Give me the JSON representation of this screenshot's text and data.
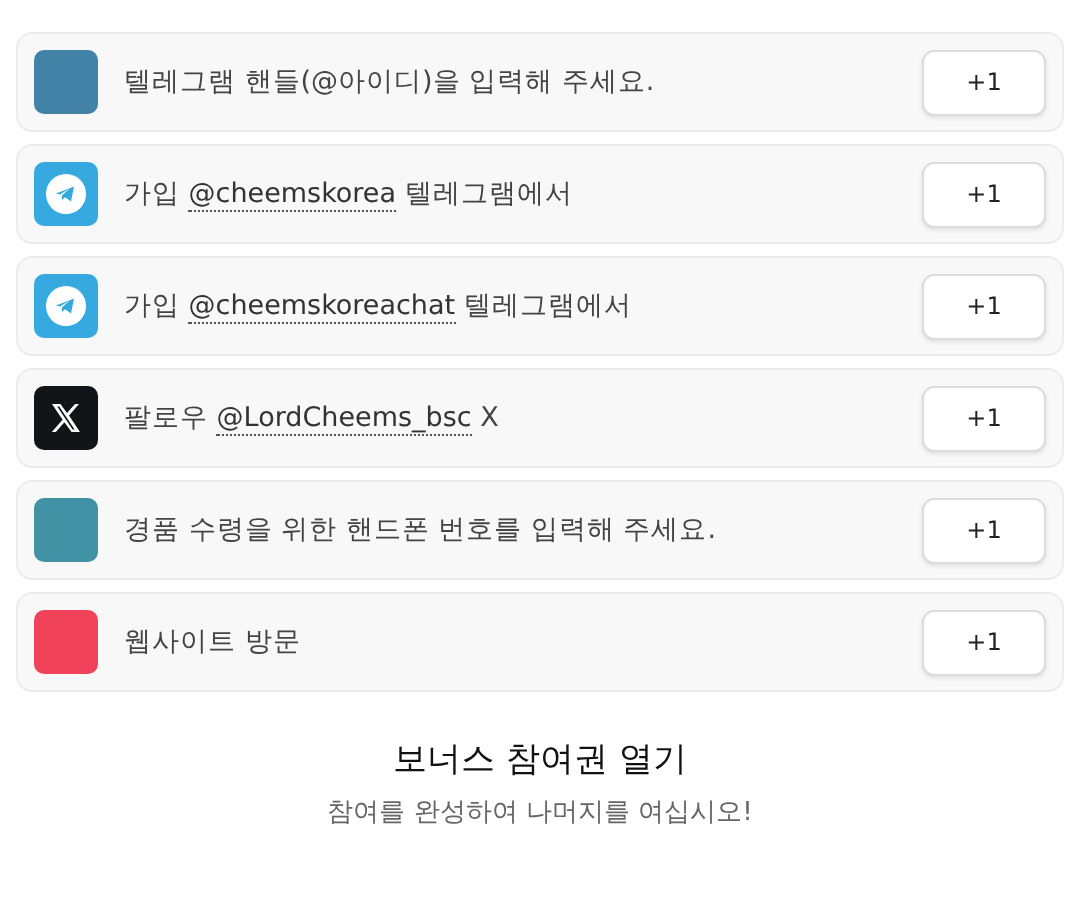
{
  "tasks": [
    {
      "kind": "plain",
      "color": "#4282a6",
      "text": "텔레그램 핸들(@아이디)을 입력해 주세요.",
      "button": "+1"
    },
    {
      "kind": "telegram",
      "color": "#35a9e0",
      "text": "가입",
      "link": "@cheemskorea",
      "suffix": "텔레그램에서",
      "button": "+1"
    },
    {
      "kind": "telegram",
      "color": "#35a9e0",
      "text": "가입",
      "link": "@cheemskoreachat",
      "suffix": "텔레그램에서",
      "button": "+1"
    },
    {
      "kind": "x",
      "color": "#111518",
      "text": "팔로우",
      "link": "@LordCheems_bsc",
      "suffix": "X",
      "button": "+1"
    },
    {
      "kind": "plain",
      "color": "#4292a6",
      "text": "경품 수령을 위한 핸드폰 번호를 입력해 주세요.",
      "button": "+1"
    },
    {
      "kind": "plain",
      "color": "#f0435a",
      "text": "웹사이트 방문",
      "button": "+1"
    }
  ],
  "footer": {
    "title": "보너스 참여권 열기",
    "subtitle": "참여를 완성하여 나머지를 여십시오!"
  }
}
